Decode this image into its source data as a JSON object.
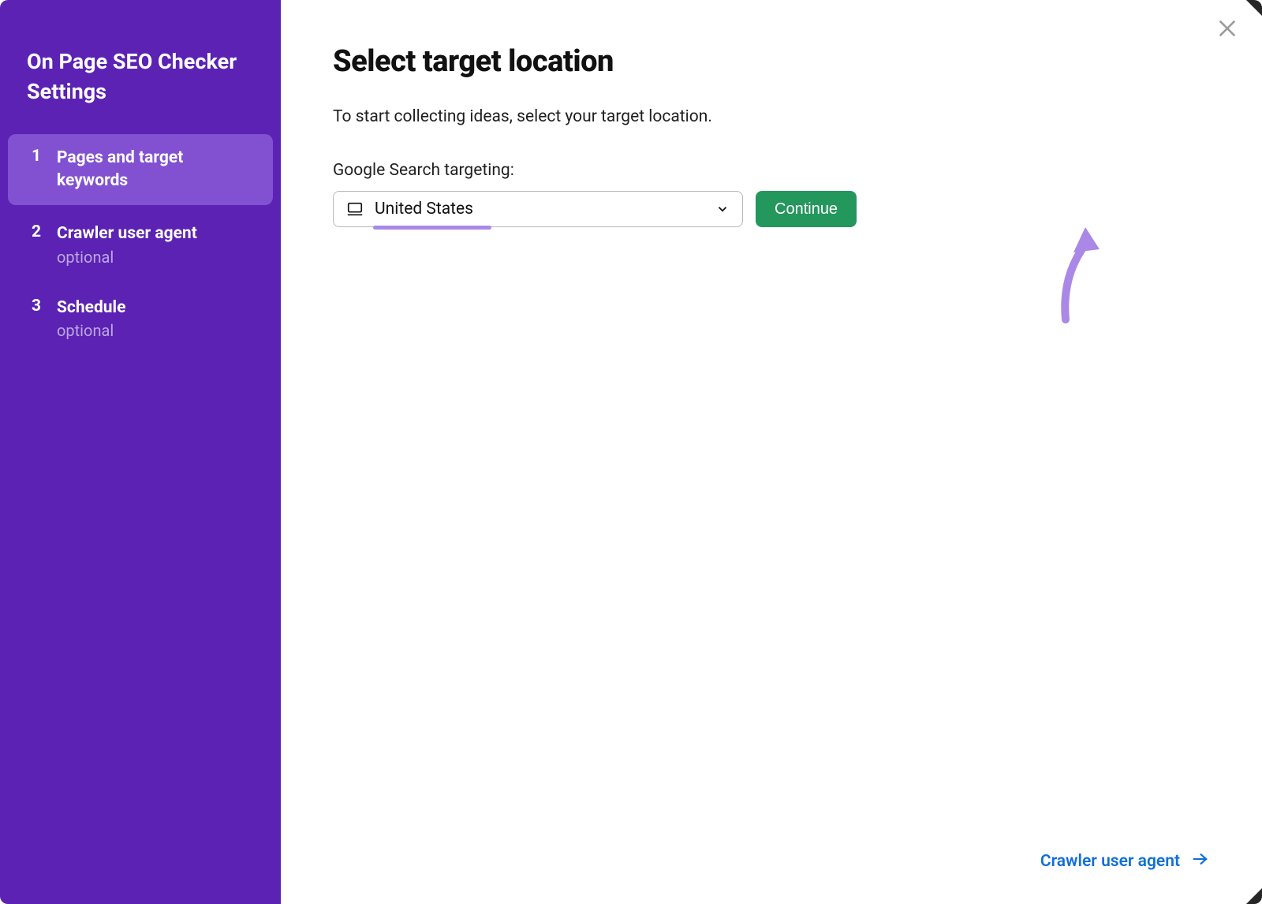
{
  "sidebar": {
    "title": "On Page SEO Checker Settings",
    "steps": [
      {
        "num": "1",
        "label": "Pages and target keywords",
        "optional": ""
      },
      {
        "num": "2",
        "label": "Crawler user agent",
        "optional": "optional"
      },
      {
        "num": "3",
        "label": "Schedule",
        "optional": "optional"
      }
    ]
  },
  "main": {
    "title": "Select target location",
    "description": "To start collecting ideas, select your target location.",
    "field_label": "Google Search targeting:",
    "location_value": "United States",
    "continue_label": "Continue"
  },
  "footer": {
    "next_label": "Crawler user agent"
  },
  "colors": {
    "sidebar_bg": "#5b22b3",
    "sidebar_active": "#8251d1",
    "accent_underline": "#a988e8",
    "continue_bg": "#24975d",
    "link": "#116fd6"
  }
}
